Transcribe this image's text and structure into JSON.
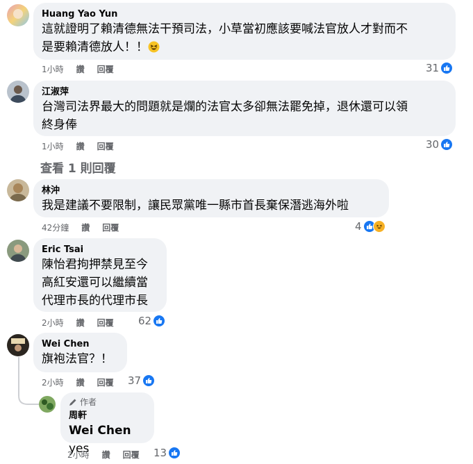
{
  "comments": [
    {
      "name": "Huang Yao Yun",
      "text": "這就證明了賴清德無法干預司法，小草當初應該要喊法官放人才對而不是要賴清德放人！！",
      "line1": "這就證明了賴清德無法干預司法，小草當初應該要喊法官放人才對而不",
      "line2": "是要賴清德放人！！",
      "time": "1小時",
      "like_label": "讚",
      "reply_label": "回覆",
      "reactions": "31"
    },
    {
      "name": "江淑萍",
      "line1": "台灣司法界最大的問題就是爛的法官太多卻無法罷免掉，退休還可以領",
      "line2": "終身俸",
      "time": "1小時",
      "like_label": "讚",
      "reply_label": "回覆",
      "reactions": "30"
    },
    {
      "name": "林沖",
      "line1": "我是建議不要限制，讓民眾黨唯一縣市首長棄保潛逃海外啦",
      "time": "42分鐘",
      "like_label": "讚",
      "reply_label": "回覆",
      "reactions": "4"
    },
    {
      "name": "Eric Tsai",
      "line1": "陳怡君拘押禁見至今",
      "line2": "高紅安還可以繼續當",
      "line3": "代理市長的代理市長",
      "time": "2小時",
      "like_label": "讚",
      "reply_label": "回覆",
      "reactions": "62"
    },
    {
      "name": "Wei Chen",
      "line1": "旗袍法官？！",
      "time": "2小時",
      "like_label": "讚",
      "reply_label": "回覆",
      "reactions": "37"
    },
    {
      "author_tag": "作者",
      "name": "周軒",
      "mention": "Wei Chen",
      "line1_rest": " yes",
      "time": "2小時",
      "like_label": "讚",
      "reply_label": "回覆",
      "reactions": "13"
    }
  ],
  "view_replies": "查看 1 則回覆",
  "colors": {
    "bubble": "#f0f2f5",
    "meta": "#65676b",
    "like_blue": "#1877f2"
  }
}
